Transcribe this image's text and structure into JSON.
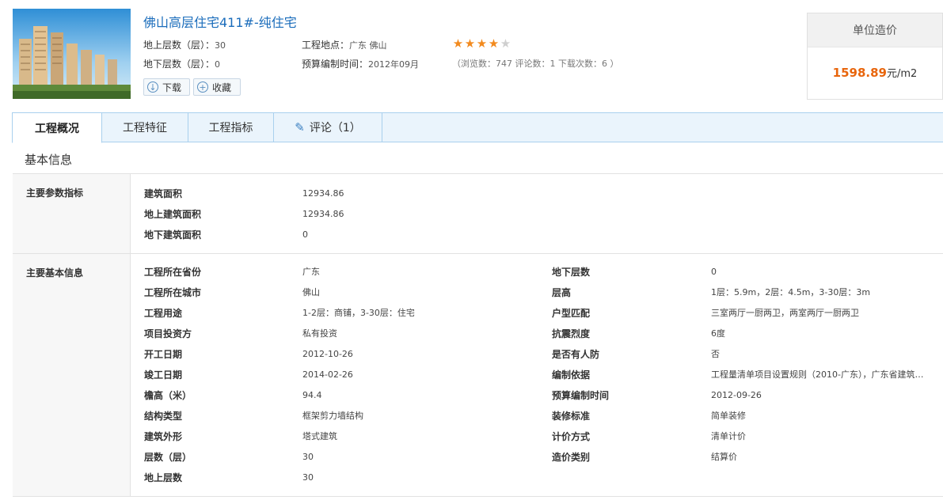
{
  "header": {
    "title": "佛山高层住宅411#-纯住宅",
    "meta": {
      "above_floors_label": "地上层数（层）：",
      "above_floors_value": "30",
      "below_floors_label": "地下层数（层）：",
      "below_floors_value": "0",
      "location_label": "工程地点：",
      "location_value": "广东 佛山",
      "budget_time_label": "预算编制时间：",
      "budget_time_value": "2012年09月"
    },
    "rating": {
      "value": 4,
      "max": 5
    },
    "stats": "（浏览数：747 评论数：1 下载次数：6 ）",
    "download_label": "下载",
    "favorite_label": "收藏"
  },
  "price": {
    "heading": "单位造价",
    "value": "1598.89",
    "unit": "元/m2",
    "accent": "#e8650c"
  },
  "tabs": [
    {
      "label": "工程概况",
      "active": true
    },
    {
      "label": "工程特征"
    },
    {
      "label": "工程指标"
    },
    {
      "label": "评论（1）",
      "icon": "pencil-icon"
    }
  ],
  "section_title": "基本信息",
  "groups": [
    {
      "label": "主要参数指标",
      "left": [
        {
          "k": "建筑面积",
          "v": "12934.86"
        },
        {
          "k": "地上建筑面积",
          "v": "12934.86"
        },
        {
          "k": "地下建筑面积",
          "v": "0"
        }
      ]
    },
    {
      "label": "主要基本信息",
      "left": [
        {
          "k": "工程所在省份",
          "v": "广东"
        },
        {
          "k": "工程所在城市",
          "v": "佛山"
        },
        {
          "k": "工程用途",
          "v": "1-2层：商铺，3-30层：住宅"
        },
        {
          "k": "项目投资方",
          "v": "私有投资"
        },
        {
          "k": "开工日期",
          "v": "2012-10-26"
        },
        {
          "k": "竣工日期",
          "v": "2014-02-26"
        },
        {
          "k": "檐高（米）",
          "v": "94.4"
        },
        {
          "k": "结构类型",
          "v": "框架剪力墙结构"
        },
        {
          "k": "建筑外形",
          "v": "塔式建筑"
        },
        {
          "k": "层数（层）",
          "v": "30"
        },
        {
          "k": "地上层数",
          "v": "30"
        }
      ],
      "right": [
        {
          "k": "地下层数",
          "v": "0"
        },
        {
          "k": "层高",
          "v": "1层：5.9m，2层：4.5m，3-30层：3m"
        },
        {
          "k": "户型匹配",
          "v": "三室两厅一厨两卫，两室两厅一厨两卫"
        },
        {
          "k": "抗震烈度",
          "v": "6度"
        },
        {
          "k": "是否有人防",
          "v": "否"
        },
        {
          "k": "编制依据",
          "v": "工程量清单项目设置规则（2010-广东），广东省建筑…"
        },
        {
          "k": "预算编制时间",
          "v": "2012-09-26"
        },
        {
          "k": "装修标准",
          "v": "简单装修"
        },
        {
          "k": "计价方式",
          "v": "清单计价"
        },
        {
          "k": "造价类别",
          "v": "结算价"
        }
      ]
    }
  ]
}
